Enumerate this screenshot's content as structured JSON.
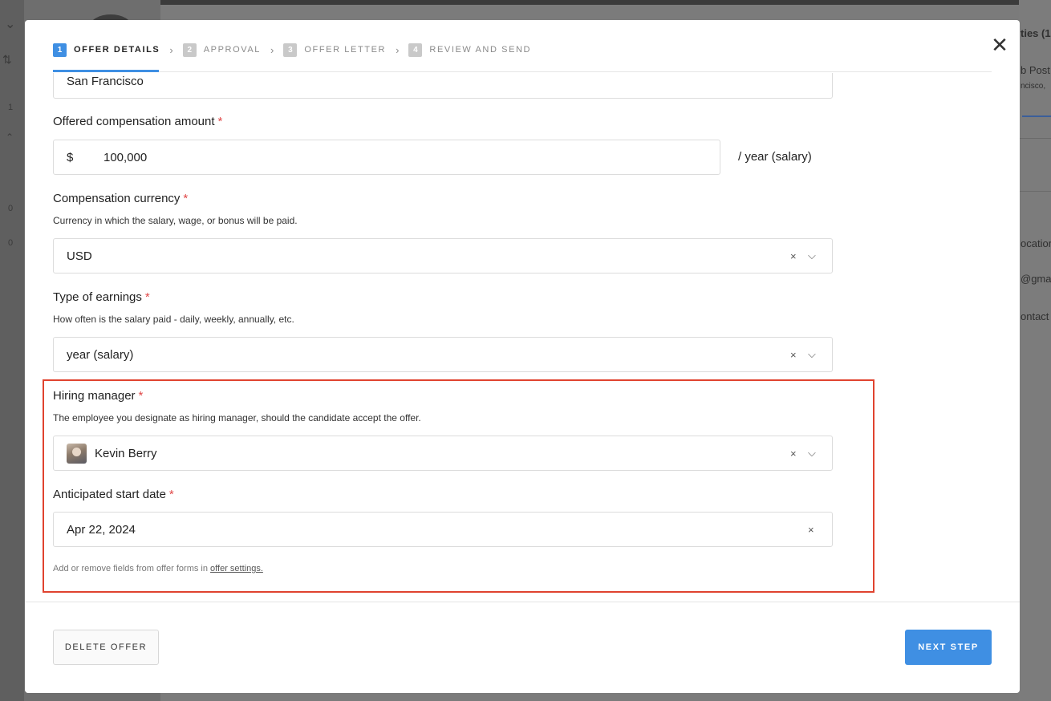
{
  "background": {
    "left_numbers": [
      "1",
      "0",
      "0"
    ],
    "right_texts": [
      "ties (1",
      "b Post",
      "ncisco,",
      "ocation",
      "@gmail",
      "ontact"
    ]
  },
  "steps": [
    {
      "num": "1",
      "label": "OFFER DETAILS",
      "active": true
    },
    {
      "num": "2",
      "label": "APPROVAL",
      "active": false
    },
    {
      "num": "3",
      "label": "OFFER LETTER",
      "active": false
    },
    {
      "num": "4",
      "label": "REVIEW AND SEND",
      "active": false
    }
  ],
  "close_label": "✕",
  "form": {
    "location_value": "San Francisco",
    "compensation": {
      "label": "Offered compensation amount",
      "required_mark": "*",
      "currency_symbol": "$",
      "value": "100,000",
      "suffix": "/ year (salary)"
    },
    "currency": {
      "label": "Compensation currency",
      "required_mark": "*",
      "help": "Currency in which the salary, wage, or bonus will be paid.",
      "value": "USD"
    },
    "earnings": {
      "label": "Type of earnings",
      "required_mark": "*",
      "help": "How often is the salary paid - daily, weekly, annually, etc.",
      "value": "year (salary)"
    },
    "hiring_manager": {
      "label": "Hiring manager",
      "required_mark": "*",
      "help": "The employee you designate as hiring manager, should the candidate accept the offer.",
      "value": "Kevin Berry"
    },
    "start_date": {
      "label": "Anticipated start date",
      "required_mark": "*",
      "value": "Apr 22, 2024"
    },
    "note_text": "Add or remove fields from offer forms in ",
    "note_link": "offer settings."
  },
  "controls": {
    "clear": "×",
    "dropdown": "⌵"
  },
  "footer": {
    "delete_label": "DELETE OFFER",
    "next_label": "NEXT STEP"
  },
  "colors": {
    "accent": "#3f8fe3",
    "highlight": "#e0432f",
    "required": "#e04848"
  }
}
